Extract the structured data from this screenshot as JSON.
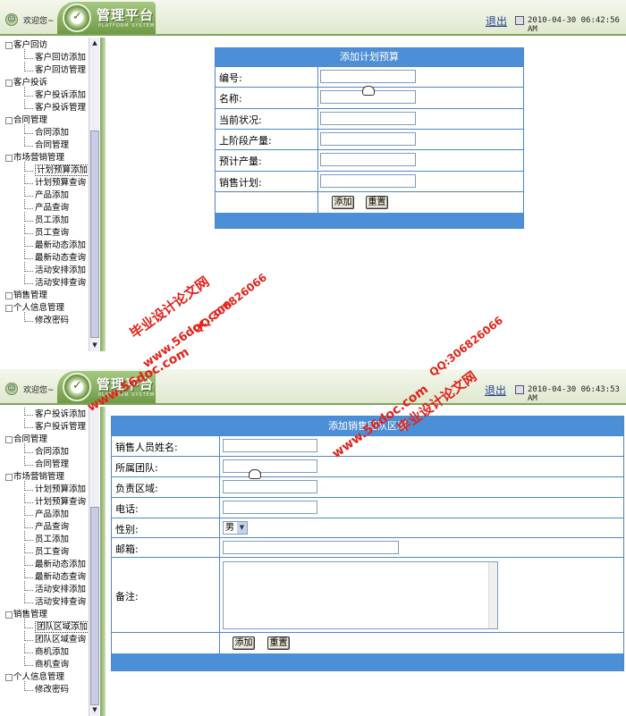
{
  "screens": [
    {
      "header": {
        "welcome": "欢迎您~",
        "logo_text": "管理平台",
        "logo_sub": "PLATFORM SYSTEM",
        "logout": "退出",
        "datetime": "2010-04-30 06:42:56 AM"
      },
      "sidebar": [
        {
          "type": "group",
          "label": "客户回访"
        },
        {
          "type": "child",
          "label": "客户回访添加"
        },
        {
          "type": "child",
          "label": "客户回访管理"
        },
        {
          "type": "group",
          "label": "客户投诉"
        },
        {
          "type": "child",
          "label": "客户投诉添加"
        },
        {
          "type": "child",
          "label": "客户投诉管理"
        },
        {
          "type": "group",
          "label": "合同管理"
        },
        {
          "type": "child",
          "label": "合同添加"
        },
        {
          "type": "child",
          "label": "合同管理"
        },
        {
          "type": "group",
          "label": "市场营销管理"
        },
        {
          "type": "child",
          "label": "计划预算添加",
          "selected": true
        },
        {
          "type": "child",
          "label": "计划预算查询"
        },
        {
          "type": "child",
          "label": "产品添加"
        },
        {
          "type": "child",
          "label": "产品查询"
        },
        {
          "type": "child",
          "label": "员工添加"
        },
        {
          "type": "child",
          "label": "员工查询"
        },
        {
          "type": "child",
          "label": "最新动态添加"
        },
        {
          "type": "child",
          "label": "最新动态查询"
        },
        {
          "type": "child",
          "label": "活动安排添加"
        },
        {
          "type": "child",
          "label": "活动安排查询"
        },
        {
          "type": "group",
          "label": "销售管理"
        },
        {
          "type": "group",
          "label": "个人信息管理"
        },
        {
          "type": "child",
          "label": "修改密码"
        }
      ],
      "form": {
        "title": "添加计划预算",
        "fields": [
          {
            "label": "编号:",
            "value": ""
          },
          {
            "label": "名称:",
            "value": ""
          },
          {
            "label": "当前状况:",
            "value": ""
          },
          {
            "label": "上阶段产量:",
            "value": ""
          },
          {
            "label": "预计产量:",
            "value": ""
          },
          {
            "label": "销售计划:",
            "value": ""
          }
        ],
        "buttons": {
          "add": "添加",
          "reset": "重置"
        }
      }
    },
    {
      "header": {
        "welcome": "欢迎您~",
        "logo_text": "管理平台",
        "logo_sub": "PLATFORM SYSTEM",
        "logout": "退出",
        "datetime": "2010-04-30 06:43:53 AM"
      },
      "sidebar": [
        {
          "type": "child",
          "label": "客户投诉添加"
        },
        {
          "type": "child",
          "label": "客户投诉管理"
        },
        {
          "type": "group",
          "label": "合同管理"
        },
        {
          "type": "child",
          "label": "合同添加"
        },
        {
          "type": "child",
          "label": "合同管理"
        },
        {
          "type": "group",
          "label": "市场营销管理"
        },
        {
          "type": "child",
          "label": "计划预算添加"
        },
        {
          "type": "child",
          "label": "计划预算查询"
        },
        {
          "type": "child",
          "label": "产品添加"
        },
        {
          "type": "child",
          "label": "产品查询"
        },
        {
          "type": "child",
          "label": "员工添加"
        },
        {
          "type": "child",
          "label": "员工查询"
        },
        {
          "type": "child",
          "label": "最新动态添加"
        },
        {
          "type": "child",
          "label": "最新动态查询"
        },
        {
          "type": "child",
          "label": "活动安排添加"
        },
        {
          "type": "child",
          "label": "活动安排查询"
        },
        {
          "type": "group",
          "label": "销售管理"
        },
        {
          "type": "child",
          "label": "团队区域添加",
          "selected": true
        },
        {
          "type": "child",
          "label": "团队区域查询"
        },
        {
          "type": "child",
          "label": "商机添加"
        },
        {
          "type": "child",
          "label": "商机查询"
        },
        {
          "type": "group",
          "label": "个人信息管理"
        },
        {
          "type": "child",
          "label": "修改密码"
        }
      ],
      "form": {
        "title": "添加销售团队区域",
        "fields": {
          "name": {
            "label": "销售人员姓名:",
            "value": ""
          },
          "team": {
            "label": "所属团队:",
            "value": ""
          },
          "region": {
            "label": "负责区域:",
            "value": ""
          },
          "phone": {
            "label": "电话:",
            "value": ""
          },
          "gender": {
            "label": "性别:",
            "value": "男"
          },
          "email": {
            "label": "邮箱:",
            "value": ""
          },
          "remarks": {
            "label": "备注:",
            "value": ""
          }
        },
        "buttons": {
          "add": "添加",
          "reset": "重置"
        }
      }
    }
  ],
  "watermarks": {
    "site": "www.56doc.com",
    "brand": "毕业设计论文网",
    "qq": "QQ:306826066"
  },
  "colors": {
    "accent": "#4d8fd6",
    "sidebar_green": "#7fa55a",
    "watermark": "#e2231a"
  }
}
